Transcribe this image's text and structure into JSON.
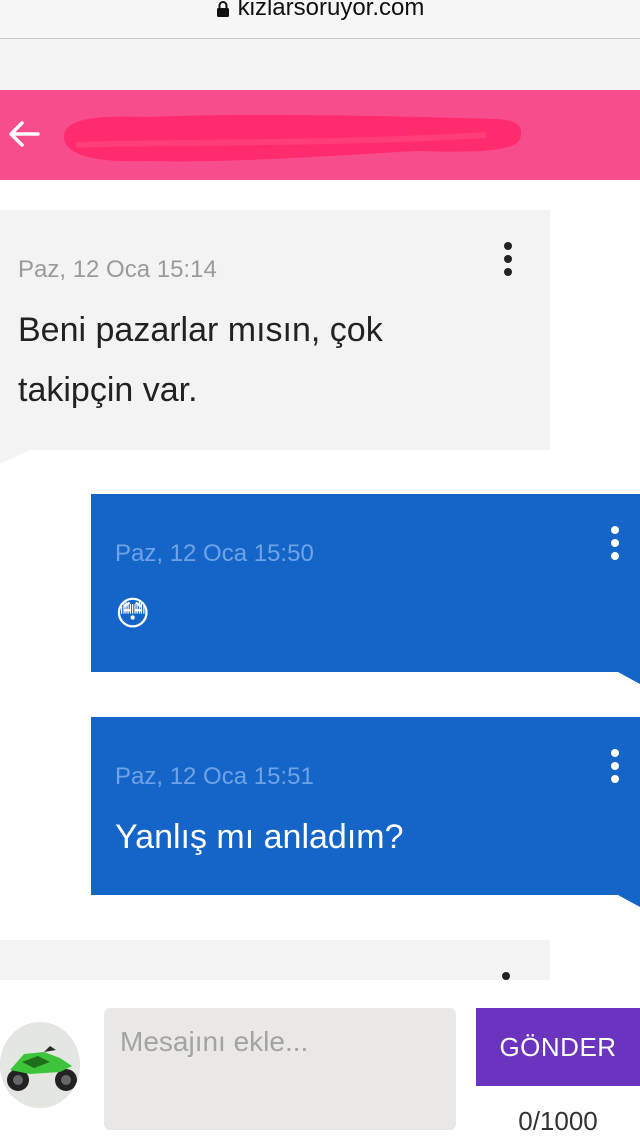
{
  "browser": {
    "url": "kizlarsoruyor.com"
  },
  "messages": [
    {
      "time": "Paz, 12 Oca 15:14",
      "text_line1": "Beni pazarlar mısın, çok",
      "text_line2": "takipçin var.",
      "direction": "incoming"
    },
    {
      "time": "Paz, 12 Oca 15:50",
      "text": "😳",
      "direction": "outgoing"
    },
    {
      "time": "Paz, 12 Oca 15:51",
      "text": "Yanlış mı anladım?",
      "direction": "outgoing"
    }
  ],
  "composer": {
    "placeholder": "Mesajını ekle...",
    "value": "",
    "send_label": "GÖNDER",
    "counter": "0/1000"
  },
  "colors": {
    "header": "#f84d8d",
    "outgoing_bubble": "#1565c8",
    "incoming_bubble": "#f3f3f3",
    "send_button": "#6b34bf"
  },
  "icons": [
    "lock-icon",
    "back-arrow-icon",
    "more-vert-icon",
    "avatar"
  ]
}
